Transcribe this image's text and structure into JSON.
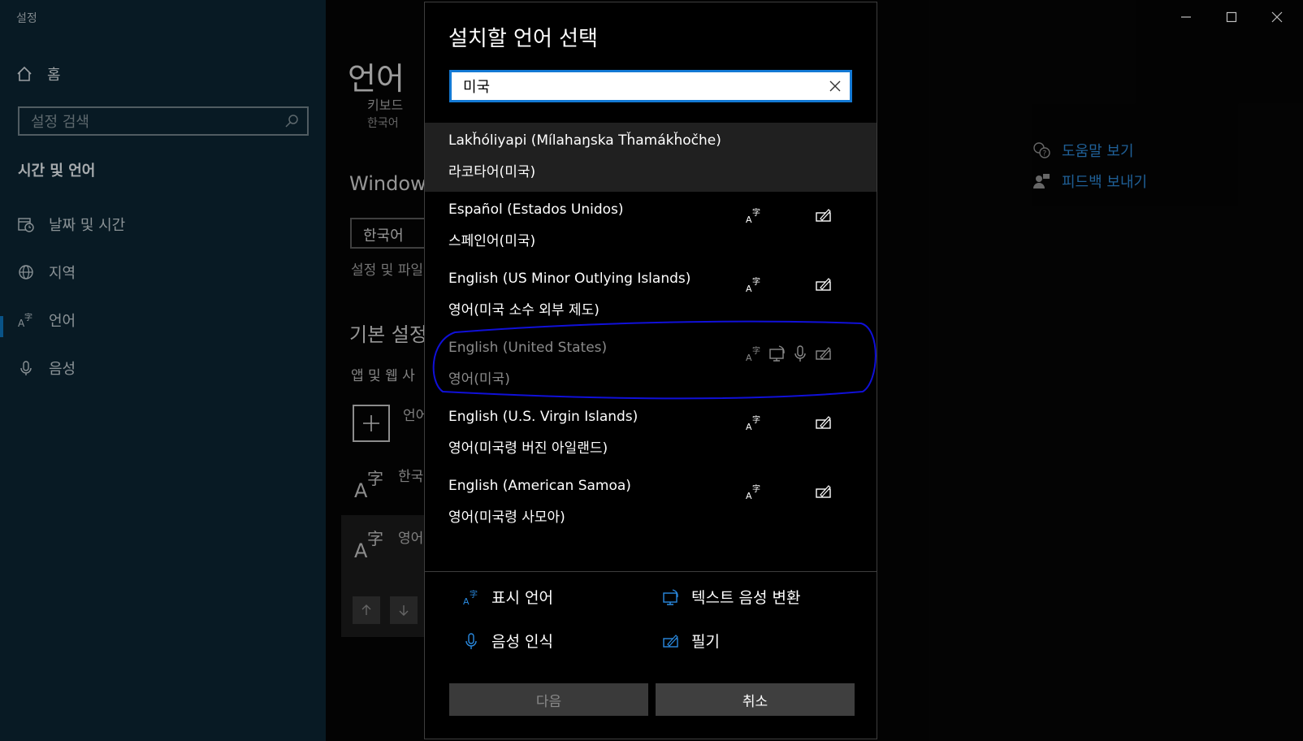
{
  "window": {
    "title": "설정"
  },
  "sidebar": {
    "home": "홈",
    "search_placeholder": "설정 검색",
    "section": "시간 및 언어",
    "items": [
      {
        "label": "날짜 및 시간",
        "icon": "calendar-clock-icon"
      },
      {
        "label": "지역",
        "icon": "globe-icon"
      },
      {
        "label": "언어",
        "icon": "language-icon"
      },
      {
        "label": "음성",
        "icon": "microphone-icon"
      }
    ]
  },
  "main": {
    "page_title": "언어",
    "sub1": "키보드",
    "sub2": "한국어",
    "windows_heading": "Window",
    "display_lang_value": "한국어",
    "files_text": "설정 및 파일",
    "default_heading": "기본 설정",
    "apps_text": "앱 및 웹 사",
    "add_lang": "언어",
    "lang1": "한국",
    "lang2": "영어"
  },
  "help": {
    "help_link": "도움말 보기",
    "feedback_link": "피드백 보내기"
  },
  "dialog": {
    "title": "설치할 언어 선택",
    "search_value": "미국",
    "languages": [
      {
        "name": "Lakȟóliyapi (Mílahaŋska Tȟamákȟočhe)",
        "native": "라코타어(미국)",
        "features": []
      },
      {
        "name": "Español (Estados Unidos)",
        "native": "스페인어(미국)",
        "features": [
          "display-language",
          "handwriting"
        ]
      },
      {
        "name": "English (US Minor Outlying Islands)",
        "native": "영어(미국 소수 외부 제도)",
        "features": [
          "display-language",
          "handwriting"
        ]
      },
      {
        "name": "English (United States)",
        "native": "영어(미국)",
        "features": [
          "display-language",
          "text-to-speech",
          "speech",
          "handwriting"
        ]
      },
      {
        "name": "English (U.S. Virgin Islands)",
        "native": "영어(미국령 버진 아일랜드)",
        "features": [
          "display-language",
          "handwriting"
        ]
      },
      {
        "name": "English (American Samoa)",
        "native": "영어(미국령 사모아)",
        "features": [
          "display-language",
          "handwriting"
        ]
      }
    ],
    "legend": {
      "display_language": "표시 언어",
      "text_to_speech": "텍스트 음성 변환",
      "speech": "음성 인식",
      "handwriting": "필기"
    },
    "next_label": "다음",
    "cancel_label": "취소"
  },
  "colors": {
    "accent": "#1379d4",
    "sidebar_bg": "#0b2330",
    "annotation": "#1010d8"
  }
}
